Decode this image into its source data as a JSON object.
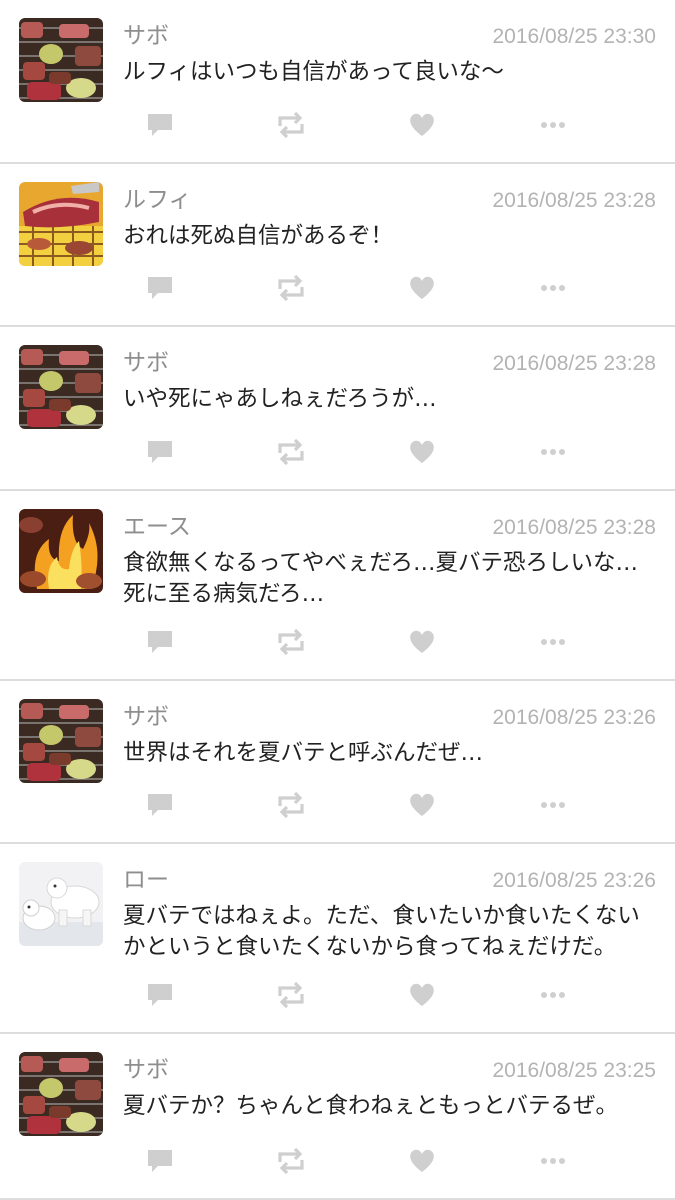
{
  "tweets": [
    {
      "user": "サボ",
      "avatar": "avatar-sabo",
      "time": "2016/08/25 23:30",
      "text": "ルフィはいつも自信があって良いな〜"
    },
    {
      "user": "ルフィ",
      "avatar": "avatar-luffy",
      "time": "2016/08/25 23:28",
      "text": "おれは死ぬ自信があるぞ！"
    },
    {
      "user": "サボ",
      "avatar": "avatar-sabo",
      "time": "2016/08/25 23:28",
      "text": "いや死にゃあしねぇだろうが…"
    },
    {
      "user": "エース",
      "avatar": "avatar-ace",
      "time": "2016/08/25 23:28",
      "text": "食欲無くなるってやべぇだろ…夏バテ恐ろしいな…死に至る病気だろ…"
    },
    {
      "user": "サボ",
      "avatar": "avatar-sabo",
      "time": "2016/08/25 23:26",
      "text": "世界はそれを夏バテと呼ぶんだぜ…"
    },
    {
      "user": "ロー",
      "avatar": "avatar-law",
      "time": "2016/08/25 23:26",
      "text": "夏バテではねぇよ。ただ、食いたいか食いたくないかというと食いたくないから食ってねぇだけだ。"
    },
    {
      "user": "サボ",
      "avatar": "avatar-sabo",
      "time": "2016/08/25 23:25",
      "text": "夏バテか？ちゃんと食わねぇともっとバテるぜ。"
    }
  ],
  "icons": {
    "reply": "reply-icon",
    "retweet": "retweet-icon",
    "like": "heart-icon",
    "more": "more-icon"
  },
  "colors": {
    "icon": "#cfcfcf",
    "name": "#8e8e8e",
    "time": "#b3b3b3",
    "text": "#222222",
    "divider": "#dcdcdc"
  }
}
